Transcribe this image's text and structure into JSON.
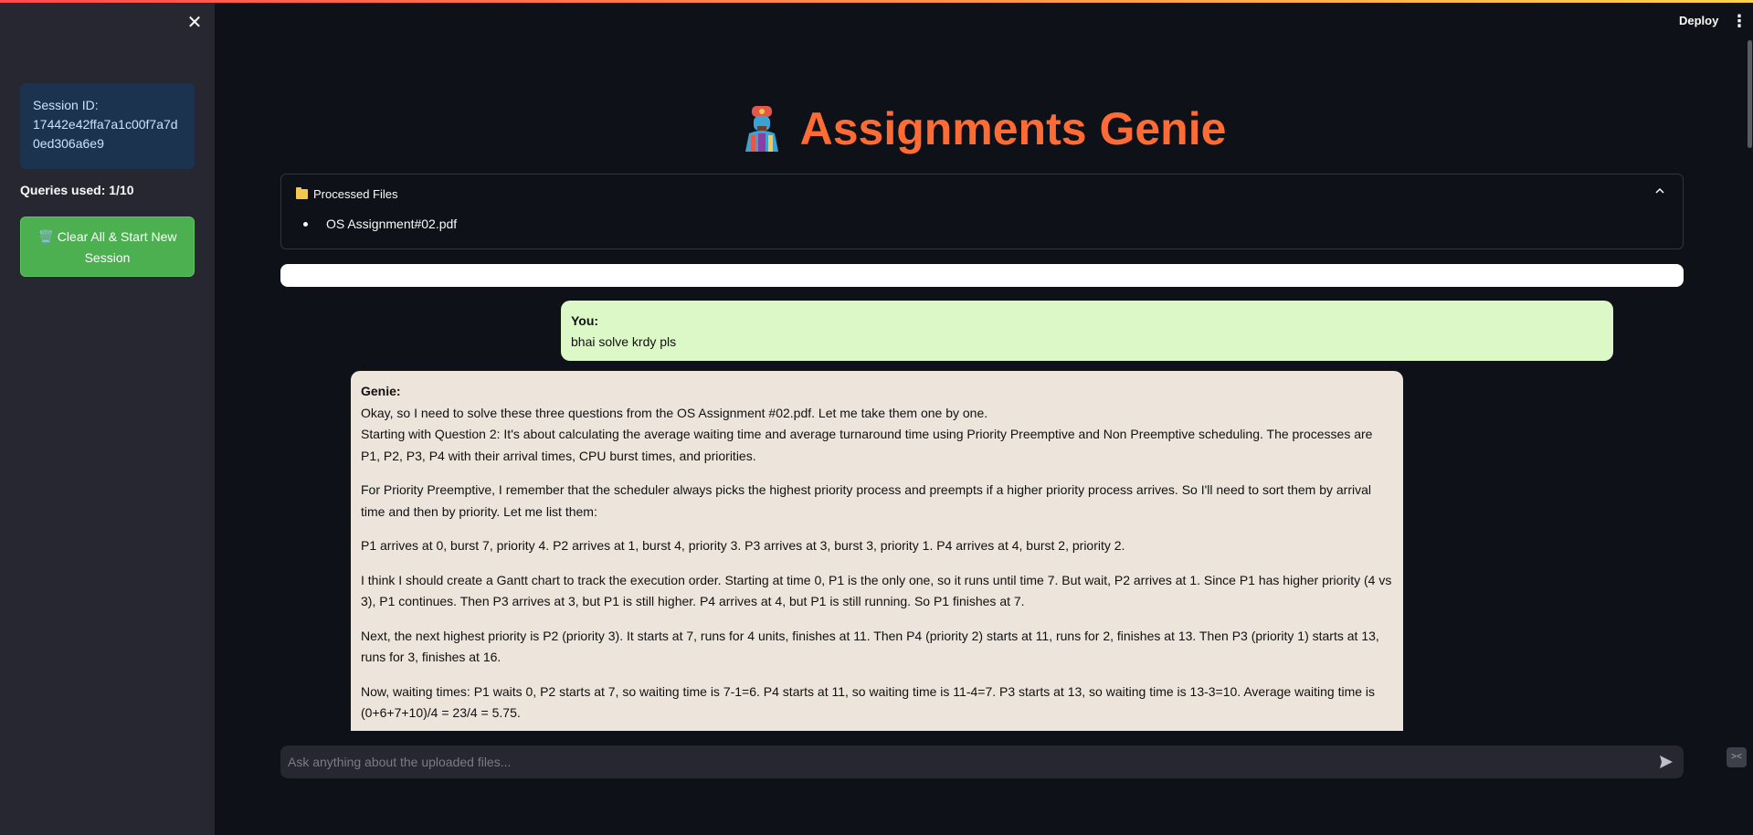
{
  "sidebar": {
    "close_label": "✕",
    "session_label": "Session ID:",
    "session_id": "17442e42ffa7a1c00f7a7d0ed306a6e9",
    "queries_used": "Queries used: 1/10",
    "clear_button": "🗑️ Clear All & Start New Session"
  },
  "header": {
    "deploy_label": "Deploy",
    "menu_label": "⋮"
  },
  "main": {
    "title": "Assignments Genie",
    "expander": {
      "label": "Processed Files",
      "files": [
        "OS Assignment#02.pdf"
      ]
    },
    "messages": [
      {
        "role_label": "You:",
        "text": "bhai solve krdy pls"
      },
      {
        "role_label": "Genie:",
        "paragraphs": [
          "Okay, so I need to solve these three questions from the OS Assignment #02.pdf. Let me take them one by one.",
          "Starting with Question 2: It's about calculating the average waiting time and average turnaround time using Priority Preemptive and Non Preemptive scheduling. The processes are P1, P2, P3, P4 with their arrival times, CPU burst times, and priorities.",
          "For Priority Preemptive, I remember that the scheduler always picks the highest priority process and preempts if a higher priority process arrives. So I'll need to sort them by arrival time and then by priority. Let me list them:",
          "P1 arrives at 0, burst 7, priority 4. P2 arrives at 1, burst 4, priority 3. P3 arrives at 3, burst 3, priority 1. P4 arrives at 4, burst 2, priority 2.",
          "I think I should create a Gantt chart to track the execution order. Starting at time 0, P1 is the only one, so it runs until time 7. But wait, P2 arrives at 1. Since P1 has higher priority (4 vs 3), P1 continues. Then P3 arrives at 3, but P1 is still higher. P4 arrives at 4, but P1 is still running. So P1 finishes at 7.",
          "Next, the next highest priority is P2 (priority 3). It starts at 7, runs for 4 units, finishes at 11. Then P4 (priority 2) starts at 11, runs for 2, finishes at 13. Then P3 (priority 1) starts at 13, runs for 3, finishes at 16.",
          "Now, waiting times: P1 waits 0, P2 starts at 7, so waiting time is 7-1=6. P4 starts at 11, so waiting time is 11-4=7. P3 starts at 13, so waiting time is 13-3=10. Average waiting time is (0+6+7+10)/4 = 23/4 = 5.75."
        ]
      }
    ]
  },
  "chat_input": {
    "placeholder": "Ask anything about the uploaded files..."
  },
  "colors": {
    "title": "#ff6b35",
    "user_bubble": "#dcf8c6",
    "genie_bubble": "#ede4dc",
    "clear_button": "#4caf50",
    "session_box": "#1c3350"
  }
}
